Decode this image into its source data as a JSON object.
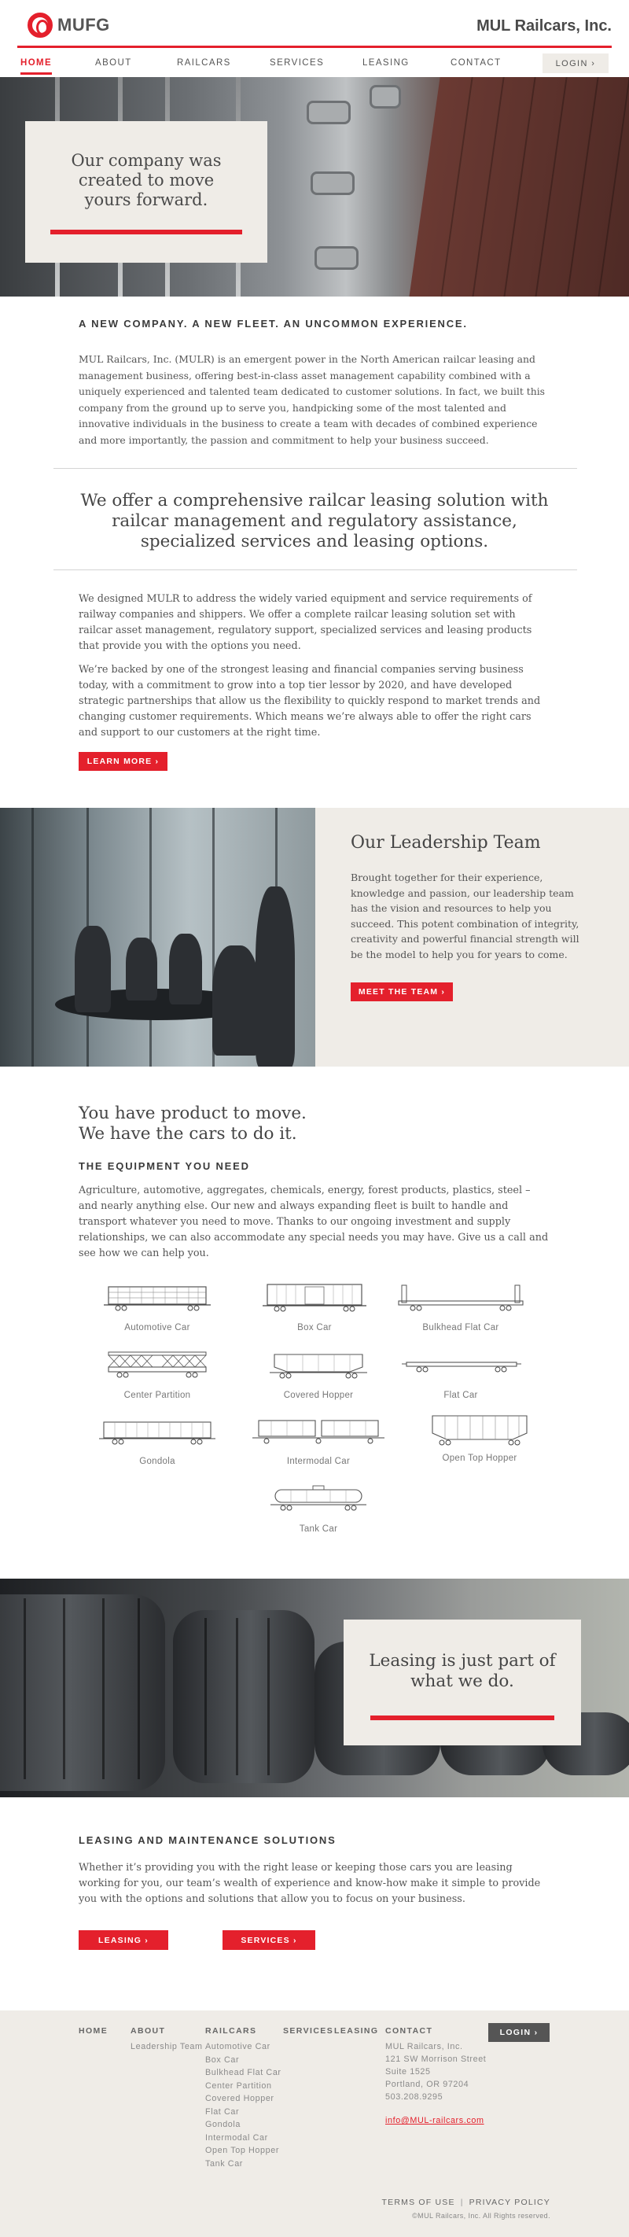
{
  "header": {
    "logo_text": "MUFG",
    "brand_name": "MUL Railcars, Inc.",
    "nav": {
      "home": "HOME",
      "about": "ABOUT",
      "railcars": "RAILCARS",
      "services": "SERVICES",
      "leasing": "LEASING",
      "contact": "CONTACT"
    },
    "login": "LOGIN ›",
    "active_nav": "home",
    "accent_color": "#e4202c"
  },
  "hero": {
    "title": "Our company was created to move yours forward."
  },
  "intro": {
    "heading": "A NEW COMPANY. A NEW FLEET. AN UNCOMMON EXPERIENCE.",
    "body": "MUL Railcars, Inc. (MULR) is an emergent power in the North American railcar leasing and management business, offering best-in-class asset management capability combined with a uniquely experienced and talented team dedicated to customer solutions. In fact, we built this company from the ground up to serve you, handpicking some of the most talented and innovative individuals in the business to create a team with decades of combined experience and more importantly, the passion and commitment to help your business succeed."
  },
  "offer": {
    "text": "We offer a comprehensive railcar leasing solution with railcar management and regulatory assistance, specialized services and leasing options."
  },
  "designed": {
    "p1": "We designed MULR to address the widely varied equipment and service requirements of railway companies and shippers. We offer a complete railcar leasing solution set with railcar asset management, regulatory support, specialized services and leasing products that provide you with the options you need.",
    "p2": "We’re backed by one of the strongest leasing and financial companies serving business today, with a commitment to grow into a top tier lessor by 2020, and have developed strategic partnerships that allow us the flexibility to quickly respond to market trends and changing customer requirements. Which means we’re always able to offer the right cars and support to our customers at the right time.",
    "button": "LEARN MORE ›"
  },
  "leadership": {
    "title": "Our Leadership Team",
    "body": "Brought together for their experience, knowledge and passion, our leadership team has the vision and resources to help you succeed. This potent combination of integrity, creativity and powerful financial strength will be the model to help you for years to come.",
    "button": "MEET THE TEAM ›"
  },
  "product": {
    "title_line1": "You have product to move.",
    "title_line2": "We have the cars to do it.",
    "equipment_heading": "THE EQUIPMENT YOU NEED",
    "body": "Agriculture, automotive, aggregates, chemicals, energy, forest products, plastics, steel – and nearly anything else. Our new and always expanding fleet is built to handle and transport whatever you need to move. Thanks to our ongoing investment and supply relationships, we can also accommodate any special needs you may have. Give us a call and see how we can help you.",
    "cars": [
      {
        "label": "Automotive Car",
        "icon": "automotive-car-icon"
      },
      {
        "label": "Box Car",
        "icon": "box-car-icon"
      },
      {
        "label": "Bulkhead Flat Car",
        "icon": "bulkhead-flat-car-icon"
      },
      {
        "label": "Center Partition",
        "icon": "center-partition-icon"
      },
      {
        "label": "Covered Hopper",
        "icon": "covered-hopper-icon"
      },
      {
        "label": "Flat Car",
        "icon": "flat-car-icon"
      },
      {
        "label": "Gondola",
        "icon": "gondola-icon"
      },
      {
        "label": "Intermodal Car",
        "icon": "intermodal-car-icon"
      },
      {
        "label": "Open Top Hopper",
        "icon": "open-top-hopper-icon"
      },
      {
        "label": "Tank Car",
        "icon": "tank-car-icon"
      }
    ]
  },
  "lease_hero": {
    "title": "Leasing is just part of what we do."
  },
  "solutions": {
    "heading": "LEASING AND MAINTENANCE SOLUTIONS",
    "body": "Whether it’s providing you with the right lease or keeping those cars you are leasing working for you, our team’s wealth of experience and know-how make it simple to provide you with the options and solutions that allow you to focus on your business.",
    "leasing_button": "LEASING ›",
    "services_button": "SERVICES ›"
  },
  "footer": {
    "home": "HOME",
    "about": "ABOUT",
    "about_links": [
      "Leadership Team"
    ],
    "railcars": "RAILCARS",
    "railcar_links": [
      "Automotive Car",
      "Box Car",
      "Bulkhead Flat Car",
      "Center Partition",
      "Covered Hopper",
      "Flat Car",
      "Gondola",
      "Intermodal Car",
      "Open Top Hopper",
      "Tank Car"
    ],
    "services": "SERVICES",
    "leasing": "LEASING",
    "contact": "CONTACT",
    "contact_lines": [
      "MUL Railcars, Inc.",
      "121 SW Morrison Street",
      "Suite 1525",
      "Portland, OR 97204",
      "503.208.9295"
    ],
    "email": "info@MUL-railcars.com",
    "login": "LOGIN ›",
    "terms": "TERMS OF USE",
    "separator": "|",
    "privacy": "PRIVACY POLICY",
    "copyright": "©MUL Railcars, Inc. All Rights reserved."
  }
}
